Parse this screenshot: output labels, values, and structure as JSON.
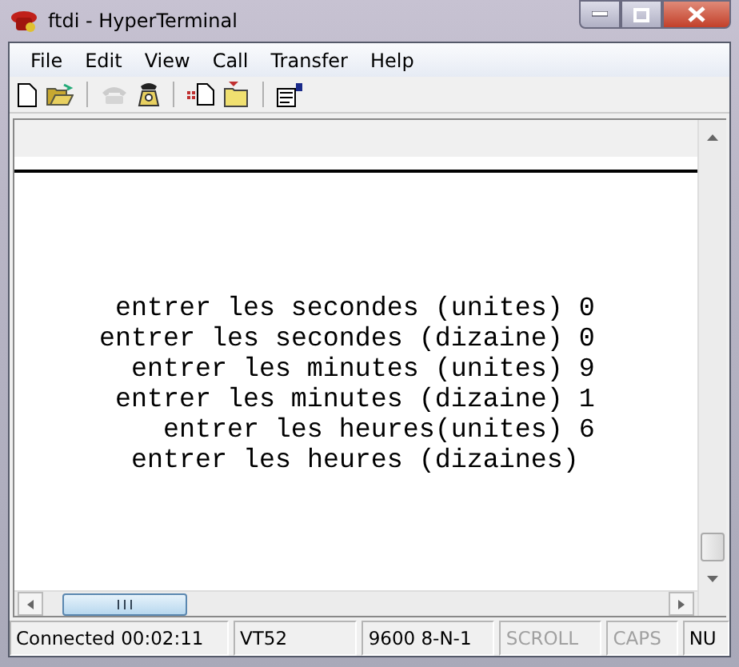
{
  "window": {
    "title": "ftdi - HyperTerminal"
  },
  "menu": [
    "File",
    "Edit",
    "View",
    "Call",
    "Transfer",
    "Help"
  ],
  "toolbar": [
    {
      "kind": "new",
      "disabled": false
    },
    {
      "kind": "open",
      "disabled": false
    },
    {
      "kind": "separator"
    },
    {
      "kind": "disconnect",
      "disabled": true
    },
    {
      "kind": "dial",
      "disabled": false
    },
    {
      "kind": "separator"
    },
    {
      "kind": "send",
      "disabled": false
    },
    {
      "kind": "receive",
      "disabled": false
    },
    {
      "kind": "separator"
    },
    {
      "kind": "properties",
      "disabled": false
    }
  ],
  "terminal": {
    "lines": [
      "entrer les secondes (unites) 0",
      "entrer les secondes (dizaine) 0",
      "entrer les minutes (unites) 9",
      "entrer les minutes (dizaine) 1",
      "entrer les heures(unites) 6",
      "entrer les heures (dizaines)"
    ]
  },
  "status_bar": [
    {
      "text": "Connected 00:02:11",
      "disabled": false
    },
    {
      "text": "VT52",
      "disabled": false
    },
    {
      "text": "9600 8-N-1",
      "disabled": false
    },
    {
      "text": "SCROLL",
      "disabled": true
    },
    {
      "text": "CAPS",
      "disabled": true
    },
    {
      "text": "NU",
      "disabled": false
    }
  ]
}
